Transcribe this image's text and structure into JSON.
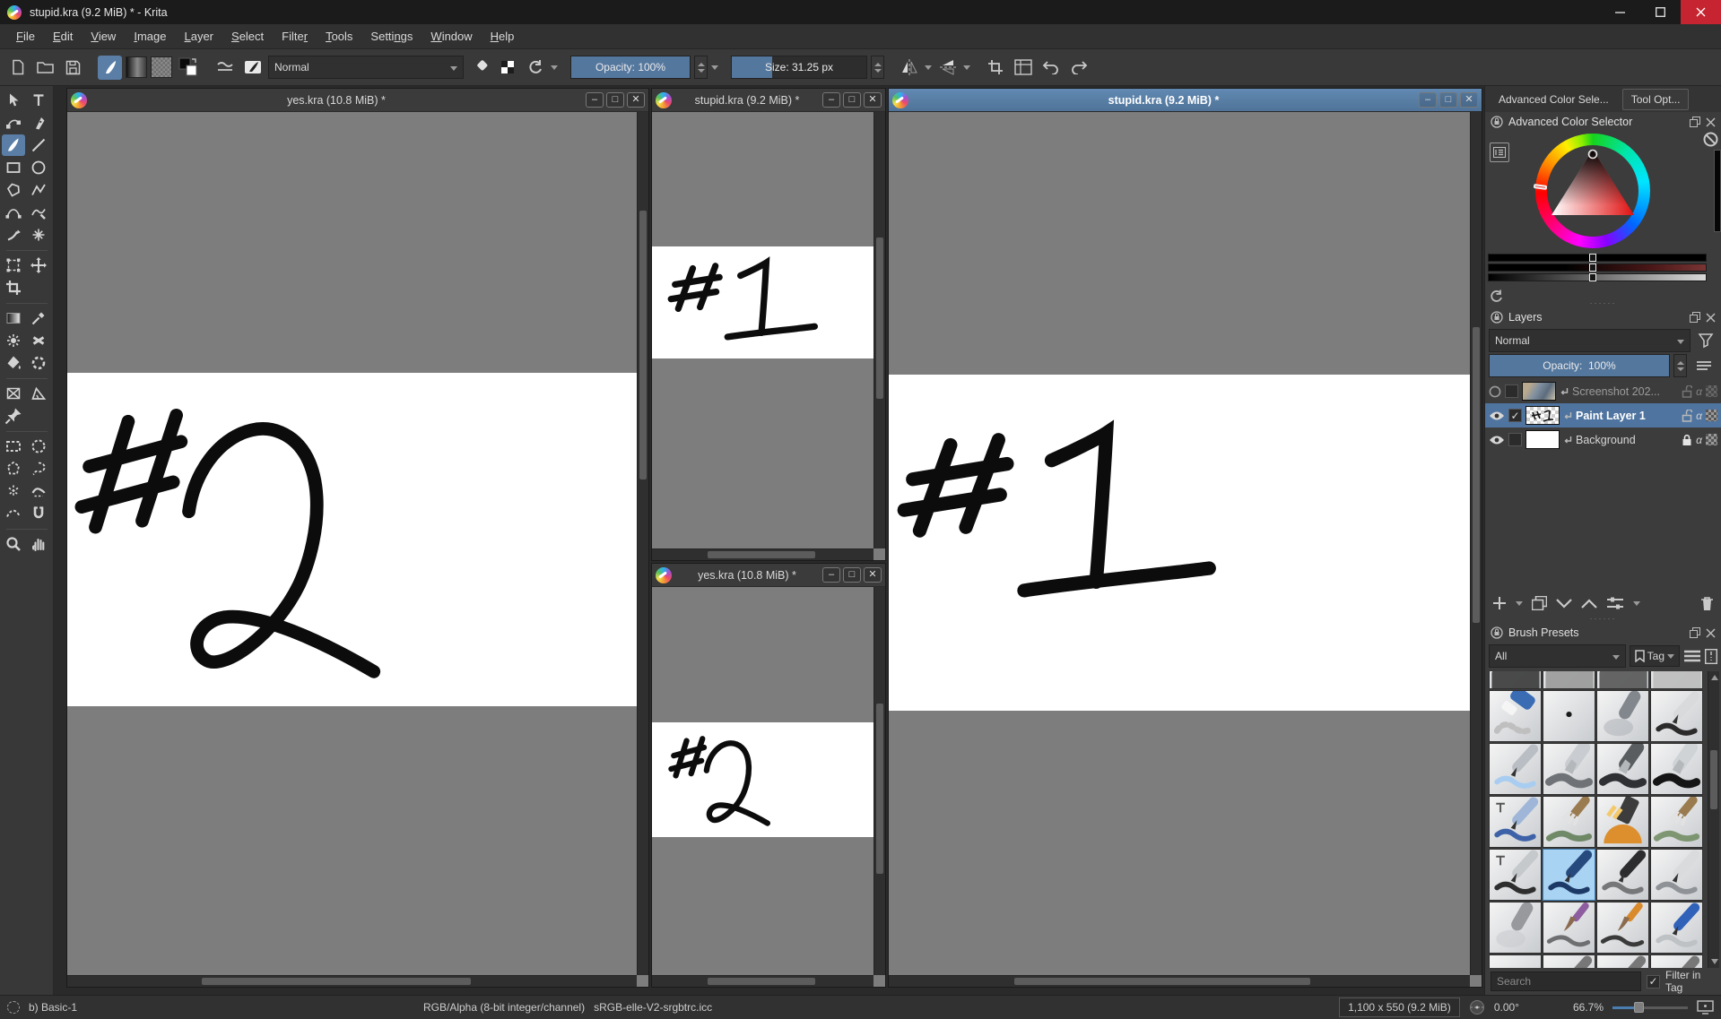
{
  "window": {
    "title": "stupid.kra (9.2 MiB) * - Krita"
  },
  "menu": {
    "items": [
      {
        "label": "File",
        "u": 0
      },
      {
        "label": "Edit",
        "u": 0
      },
      {
        "label": "View",
        "u": 0
      },
      {
        "label": "Image",
        "u": 0
      },
      {
        "label": "Layer",
        "u": 0
      },
      {
        "label": "Select",
        "u": 0
      },
      {
        "label": "Filter",
        "u": 5
      },
      {
        "label": "Tools",
        "u": 0
      },
      {
        "label": "Settings",
        "u": 5
      },
      {
        "label": "Window",
        "u": 0
      },
      {
        "label": "Help",
        "u": 0
      }
    ]
  },
  "toolbar": {
    "blend_mode": "Normal",
    "opacity": "Opacity: 100%",
    "size": "Size: 31.25 px"
  },
  "toolbox": {
    "tools": [
      {
        "icon": "arrow",
        "name": "select-shapes-tool"
      },
      {
        "icon": "text",
        "name": "text-tool"
      },
      {
        "icon": "nodes",
        "name": "edit-shapes-tool"
      },
      {
        "icon": "calligraphy",
        "name": "calligraphy-tool"
      },
      {
        "icon": "brush",
        "name": "freehand-brush-tool",
        "active": true
      },
      {
        "icon": "line",
        "name": "line-tool"
      },
      {
        "icon": "rect",
        "name": "rectangle-tool"
      },
      {
        "icon": "ellipse",
        "name": "ellipse-tool"
      },
      {
        "icon": "polygon",
        "name": "polygon-tool"
      },
      {
        "icon": "polyline",
        "name": "polyline-tool"
      },
      {
        "icon": "bezier",
        "name": "bezier-curve-tool"
      },
      {
        "icon": "freepath",
        "name": "freehand-path-tool"
      },
      {
        "icon": "dyna",
        "name": "dynamic-brush-tool"
      },
      {
        "icon": "multi",
        "name": "multibrush-tool"
      },
      {
        "div": true
      },
      {
        "icon": "transform",
        "name": "transform-tool"
      },
      {
        "icon": "move",
        "name": "move-tool"
      },
      {
        "icon": "crop",
        "name": "crop-tool"
      },
      {
        "spacer": true
      },
      {
        "div": true
      },
      {
        "icon": "gradient",
        "name": "gradient-tool"
      },
      {
        "icon": "picker",
        "name": "color-sampler-tool"
      },
      {
        "icon": "patch",
        "name": "colorize-mask-tool"
      },
      {
        "icon": "smart",
        "name": "smart-patch-tool"
      },
      {
        "icon": "fill",
        "name": "fill-tool"
      },
      {
        "icon": "enclose",
        "name": "enclose-fill-tool"
      },
      {
        "div": true
      },
      {
        "icon": "assist",
        "name": "assistants-tool"
      },
      {
        "icon": "measure",
        "name": "measure-tool"
      },
      {
        "icon": "pin",
        "name": "reference-images-tool"
      },
      {
        "spacer": true
      },
      {
        "div": true
      },
      {
        "icon": "selrect",
        "name": "rectangular-selection-tool"
      },
      {
        "icon": "selellipse",
        "name": "elliptical-selection-tool"
      },
      {
        "icon": "selpoly",
        "name": "polygonal-selection-tool"
      },
      {
        "icon": "lasso",
        "name": "freehand-selection-tool"
      },
      {
        "icon": "selwand",
        "name": "similar-color-selection-tool"
      },
      {
        "icon": "selcont",
        "name": "contiguous-selection-tool"
      },
      {
        "icon": "selbez",
        "name": "bezier-selection-tool"
      },
      {
        "icon": "selmag",
        "name": "magnetic-selection-tool"
      },
      {
        "div": true
      },
      {
        "icon": "zoom",
        "name": "zoom-tool"
      },
      {
        "icon": "hand",
        "name": "pan-tool"
      }
    ]
  },
  "windows": [
    {
      "title": "yes.kra (10.8 MiB) *",
      "drawing": "#2",
      "active": false
    },
    {
      "title": "stupid.kra (9.2 MiB) *",
      "drawing": "#1",
      "active": false
    },
    {
      "title": "yes.kra (10.8 MiB) *",
      "drawing": "#2",
      "active": false
    },
    {
      "title": "stupid.kra (9.2 MiB) *",
      "drawing": "#1",
      "active": true
    }
  ],
  "right_panel": {
    "tabs": [
      {
        "label": "Advanced Color Sele..."
      },
      {
        "label": "Tool Opt..."
      }
    ],
    "color_selector": {
      "title": "Advanced Color Selector"
    },
    "layers": {
      "title": "Layers",
      "blend_mode": "Normal",
      "opacity_label": "Opacity:",
      "opacity_value": "100%",
      "rows": [
        {
          "name": "Screenshot 202...",
          "visible": false,
          "checked": false,
          "selected": false,
          "locked": false,
          "thumb": "photo"
        },
        {
          "name": "Paint Layer 1",
          "visible": true,
          "checked": true,
          "selected": true,
          "locked": false,
          "thumb": "paint"
        },
        {
          "name": "Background",
          "visible": true,
          "checked": false,
          "selected": false,
          "locked": true,
          "thumb": "white"
        }
      ]
    },
    "brush_presets": {
      "title": "Brush Presets",
      "filter_value": "All",
      "tag_label": "Tag",
      "search_placeholder": "Search",
      "filter_in_tag": "Filter in Tag",
      "brushes": [
        {
          "name": "bristle-dark",
          "kind": "smudge",
          "body": "#3a3a3a",
          "stroke": "#222"
        },
        {
          "name": "smudge-soft",
          "kind": "smudge",
          "body": "#9a9a9a",
          "stroke": "#777"
        },
        {
          "name": "chalk-grainy",
          "kind": "smudge",
          "body": "#565656",
          "stroke": "#333"
        },
        {
          "name": "sketch-ink",
          "kind": "smudge",
          "body": "#bdbdbd",
          "stroke": "#555"
        },
        {
          "name": "eraser-soft",
          "kind": "eraser",
          "body": "#3a6cb4",
          "stroke": "#bfbfbf"
        },
        {
          "name": "pixel-1",
          "kind": "dot",
          "body": "#1a1a1a",
          "stroke": "#1a1a1a"
        },
        {
          "name": "airbrush-soft",
          "kind": "airbrush",
          "body": "#82878e",
          "stroke": "#aeb3b8"
        },
        {
          "name": "ink-ballpen",
          "kind": "pen",
          "body": "#d8dadc",
          "stroke": "#2b2b2b"
        },
        {
          "name": "pencil-soft-blue",
          "kind": "pen",
          "body": "#b9bec4",
          "stroke": "#a8cdf0"
        },
        {
          "name": "marker-chisel",
          "kind": "marker",
          "body": "#c9ccd0",
          "stroke": "#6f7377"
        },
        {
          "name": "charcoal-rock",
          "kind": "marker",
          "body": "#5a5d60",
          "stroke": "#2e3033"
        },
        {
          "name": "marker-dry",
          "kind": "marker",
          "body": "#cfd3d6",
          "stroke": "#151515"
        },
        {
          "name": "texture-blue",
          "kind": "tpen",
          "body": "#9fb6d8",
          "stroke": "#3e62a8"
        },
        {
          "name": "bristle-wet-green",
          "kind": "bristle",
          "body": "#9a7b4f",
          "stroke": "#5d7a52"
        },
        {
          "name": "highlighter-orange",
          "kind": "highlight",
          "body": "#3c3c3c",
          "stroke": "#dd8f2e"
        },
        {
          "name": "bristle-grass",
          "kind": "bristle",
          "body": "#9a7b4f",
          "stroke": "#6d8a5e"
        },
        {
          "name": "marker-details-black",
          "kind": "tpen",
          "body": "#c6c9cc",
          "stroke": "#2e2e2e"
        },
        {
          "name": "basic-1",
          "kind": "pen",
          "body": "#274a7e",
          "stroke": "#1d3a66",
          "selected": true
        },
        {
          "name": "ink-precision",
          "kind": "pen",
          "body": "#2c2c2e",
          "stroke": "#757779"
        },
        {
          "name": "metal-pen",
          "kind": "pen",
          "body": "#d9dbdd",
          "stroke": "#8f9296"
        },
        {
          "name": "airbrush-pressure",
          "kind": "airbrush",
          "body": "#97999c",
          "stroke": "#c9cbcd"
        },
        {
          "name": "round-wet-purple",
          "kind": "round",
          "body": "#8e5da0",
          "stroke": "#6e6f71"
        },
        {
          "name": "fineliner-orange",
          "kind": "round",
          "body": "#d98a2b",
          "stroke": "#3a3a3a"
        },
        {
          "name": "pencil-blue-hb",
          "kind": "pen",
          "body": "#2f62b8",
          "stroke": "#bfc2c5"
        },
        {
          "name": "pencil-a",
          "kind": "pen",
          "body": "#6e7control",
          "stroke": "#444"
        },
        {
          "name": "pencil-b",
          "kind": "pen",
          "body": "#777",
          "stroke": "#444"
        },
        {
          "name": "pencil-c",
          "kind": "pen",
          "body": "#777",
          "stroke": "#444"
        },
        {
          "name": "pencil-d",
          "kind": "pen",
          "body": "#777",
          "stroke": "#444"
        }
      ]
    }
  },
  "status_bar": {
    "brush_name": "b) Basic-1",
    "color_mode": "RGB/Alpha (8-bit integer/channel)",
    "color_profile": "sRGB-elle-V2-srgbtrc.icc",
    "doc_size": "1,100 x 550 (9.2 MiB)",
    "rotation": "0.00°",
    "zoom_level": "66.7%"
  },
  "colors": {
    "accent_blue": "#54779e",
    "active_title": "#5b82ac",
    "selected_layer": "#4f74a0",
    "brush_selected": "#a9d3f2",
    "canvas_gray": "#7d7d7d"
  }
}
